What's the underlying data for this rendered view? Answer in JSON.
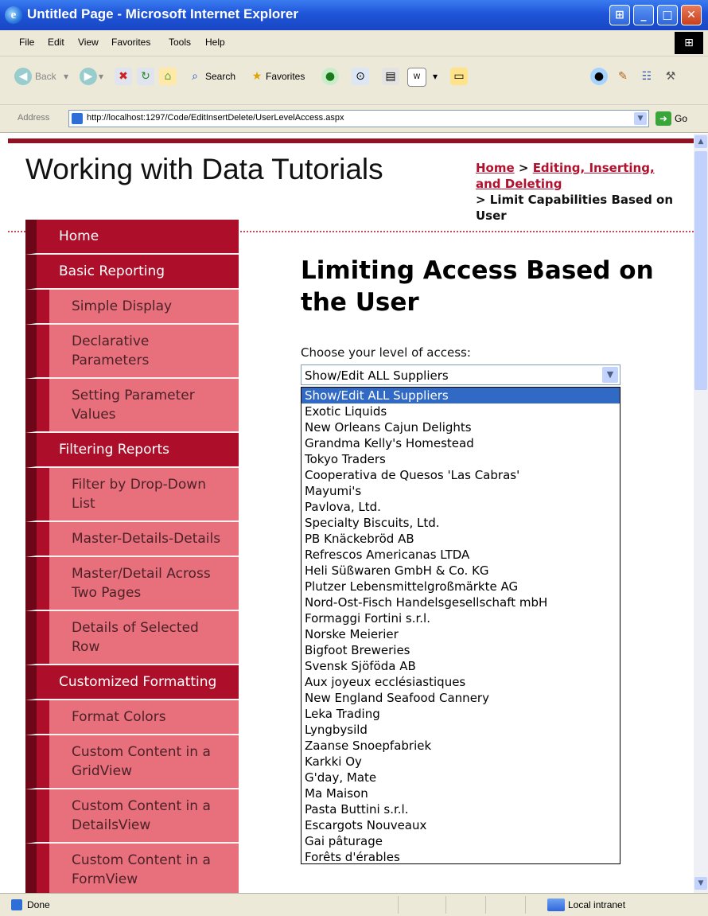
{
  "window": {
    "title": "Untitled Page - Microsoft Internet Explorer",
    "icon": "internet-explorer-icon",
    "controls": [
      "restore-icon",
      "minimize-icon",
      "maximize-icon",
      "close-icon"
    ]
  },
  "menu": [
    "File",
    "Edit",
    "View",
    "Favorites",
    "Tools",
    "Help"
  ],
  "toolbar": {
    "back": "Back",
    "search": "Search",
    "favorites": "Favorites"
  },
  "address": {
    "label": "Address",
    "url": "http://localhost:1297/Code/EditInsertDelete/UserLevelAccess.aspx",
    "go": "Go"
  },
  "site": {
    "title": "Working with Data Tutorials",
    "accent_color": "#ad0e2a",
    "breadcrumb": {
      "home": "Home",
      "sep1": " > ",
      "section": "Editing, Inserting, and Deleting",
      "current": "> Limit Capabilities Based on User"
    }
  },
  "sidebar": [
    {
      "label": "Home",
      "level": "top"
    },
    {
      "label": "Basic Reporting",
      "level": "top"
    },
    {
      "label": "Simple Display",
      "level": "sub"
    },
    {
      "label": "Declarative Parameters",
      "level": "sub"
    },
    {
      "label": "Setting Parameter Values",
      "level": "sub"
    },
    {
      "label": "Filtering Reports",
      "level": "top"
    },
    {
      "label": "Filter by Drop-Down List",
      "level": "sub"
    },
    {
      "label": "Master-Details-Details",
      "level": "sub"
    },
    {
      "label": "Master/Detail Across Two Pages",
      "level": "sub"
    },
    {
      "label": "Details of Selected Row",
      "level": "sub"
    },
    {
      "label": "Customized Formatting",
      "level": "top"
    },
    {
      "label": "Format Colors",
      "level": "sub"
    },
    {
      "label": "Custom Content in a GridView",
      "level": "sub"
    },
    {
      "label": "Custom Content in a DetailsView",
      "level": "sub"
    },
    {
      "label": "Custom Content in a FormView",
      "level": "sub"
    }
  ],
  "main": {
    "heading": "Limiting Access Based on the User",
    "access_label": "Choose your level of access:",
    "selected": "Show/Edit ALL Suppliers",
    "options": [
      "Show/Edit ALL Suppliers",
      "Exotic Liquids",
      "New Orleans Cajun Delights",
      "Grandma Kelly's Homestead",
      "Tokyo Traders",
      "Cooperativa de Quesos 'Las Cabras'",
      "Mayumi's",
      "Pavlova, Ltd.",
      "Specialty Biscuits, Ltd.",
      "PB Knäckebröd AB",
      "Refrescos Americanas LTDA",
      "Heli Süßwaren GmbH & Co. KG",
      "Plutzer Lebensmittelgroßmärkte AG",
      "Nord-Ost-Fisch Handelsgesellschaft mbH",
      "Formaggi Fortini s.r.l.",
      "Norske Meierier",
      "Bigfoot Breweries",
      "Svensk Sjöföda AB",
      "Aux joyeux ecclésiastiques",
      "New England Seafood Cannery",
      "Leka Trading",
      "Lyngbysild",
      "Zaanse Snoepfabriek",
      "Karkki Oy",
      "G'day, Mate",
      "Ma Maison",
      "Pasta Buttini s.r.l.",
      "Escargots Nouveaux",
      "Gai pâturage",
      "Forêts d'érables"
    ]
  },
  "status": {
    "left": "Done",
    "zone": "Local intranet"
  }
}
